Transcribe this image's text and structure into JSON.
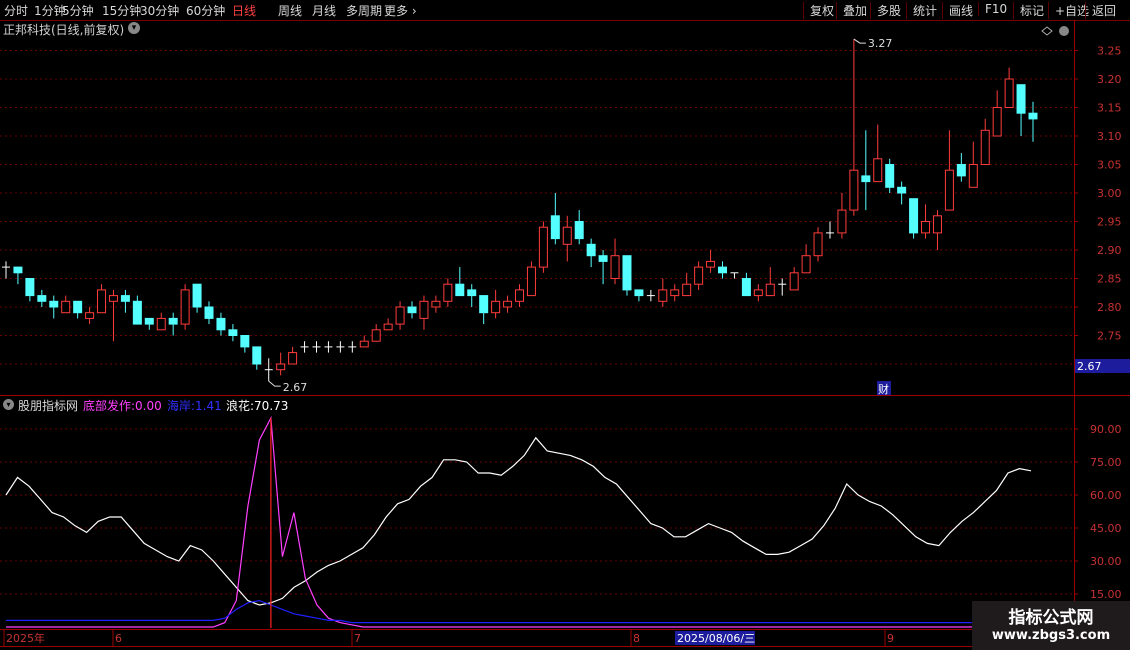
{
  "toolbar": {
    "left": [
      "分时",
      "1分钟",
      "5分钟",
      "15分钟",
      "30分钟",
      "60分钟",
      "日线",
      "周线",
      "月线",
      "多周期",
      "更多"
    ],
    "active": "日线",
    "right": [
      "复权",
      "叠加",
      "多股",
      "统计",
      "画线",
      "F10",
      "标记",
      "+自选",
      "返回"
    ]
  },
  "title": "正邦科技(日线,前复权)",
  "price_panel": {
    "high_label": "3.27",
    "low_label": "2.67",
    "current_price": "2.67",
    "fin_marker": "财",
    "colors": {
      "up": "#ff3c3c",
      "down": "#54ffff",
      "doji": "#ffffff"
    }
  },
  "indicator_panel": {
    "name": "股朋指标网",
    "items": [
      {
        "label": "底部发作:",
        "value": "0.00",
        "color": "#ff40ff"
      },
      {
        "label": "海岸:",
        "value": "1.41",
        "color": "#2020ff"
      },
      {
        "label": "浪花:",
        "value": "70.73",
        "color": "#ffffff"
      }
    ]
  },
  "x_axis": {
    "labels": [
      "2025年",
      "6",
      "7",
      "8",
      "9"
    ],
    "cursor_date": "2025/08/06/三"
  },
  "watermark": {
    "line1": "指标公式网",
    "line2": "www.zbgs3.com"
  },
  "chart_data": [
    {
      "type": "candlestick",
      "title": "正邦科技(日线,前复权)",
      "ylim": [
        2.67,
        3.27
      ],
      "y_ticks": [
        2.7,
        2.75,
        2.8,
        2.85,
        2.9,
        2.95,
        3.0,
        3.05,
        3.1,
        3.15,
        3.2,
        3.25
      ],
      "candles": [
        [
          2.87,
          2.87,
          2.88,
          2.85
        ],
        [
          2.87,
          2.86,
          2.87,
          2.84
        ],
        [
          2.85,
          2.82,
          2.85,
          2.81
        ],
        [
          2.82,
          2.81,
          2.83,
          2.8
        ],
        [
          2.81,
          2.8,
          2.82,
          2.78
        ],
        [
          2.79,
          2.81,
          2.82,
          2.79
        ],
        [
          2.81,
          2.79,
          2.81,
          2.78
        ],
        [
          2.78,
          2.79,
          2.8,
          2.77
        ],
        [
          2.79,
          2.83,
          2.84,
          2.79
        ],
        [
          2.81,
          2.82,
          2.83,
          2.74
        ],
        [
          2.82,
          2.81,
          2.83,
          2.79
        ],
        [
          2.81,
          2.77,
          2.82,
          2.77
        ],
        [
          2.78,
          2.77,
          2.78,
          2.76
        ],
        [
          2.76,
          2.78,
          2.79,
          2.76
        ],
        [
          2.78,
          2.77,
          2.79,
          2.75
        ],
        [
          2.77,
          2.83,
          2.84,
          2.76
        ],
        [
          2.84,
          2.8,
          2.84,
          2.79
        ],
        [
          2.8,
          2.78,
          2.81,
          2.77
        ],
        [
          2.78,
          2.76,
          2.79,
          2.75
        ],
        [
          2.76,
          2.75,
          2.77,
          2.74
        ],
        [
          2.75,
          2.73,
          2.75,
          2.72
        ],
        [
          2.73,
          2.7,
          2.73,
          2.69
        ],
        [
          2.69,
          2.69,
          2.71,
          2.67
        ],
        [
          2.69,
          2.7,
          2.72,
          2.68
        ],
        [
          2.7,
          2.72,
          2.73,
          2.7
        ],
        [
          2.73,
          2.73,
          2.74,
          2.72
        ],
        [
          2.73,
          2.73,
          2.74,
          2.72
        ],
        [
          2.73,
          2.73,
          2.74,
          2.72
        ],
        [
          2.73,
          2.73,
          2.74,
          2.72
        ],
        [
          2.73,
          2.73,
          2.74,
          2.72
        ],
        [
          2.73,
          2.74,
          2.75,
          2.73
        ],
        [
          2.74,
          2.76,
          2.77,
          2.74
        ],
        [
          2.76,
          2.77,
          2.78,
          2.76
        ],
        [
          2.77,
          2.8,
          2.81,
          2.76
        ],
        [
          2.8,
          2.79,
          2.81,
          2.78
        ],
        [
          2.78,
          2.81,
          2.82,
          2.76
        ],
        [
          2.8,
          2.81,
          2.82,
          2.79
        ],
        [
          2.81,
          2.84,
          2.85,
          2.8
        ],
        [
          2.84,
          2.82,
          2.87,
          2.82
        ],
        [
          2.83,
          2.82,
          2.84,
          2.8
        ],
        [
          2.82,
          2.79,
          2.82,
          2.77
        ],
        [
          2.79,
          2.81,
          2.83,
          2.78
        ],
        [
          2.8,
          2.81,
          2.82,
          2.79
        ],
        [
          2.81,
          2.83,
          2.84,
          2.8
        ],
        [
          2.82,
          2.87,
          2.88,
          2.82
        ],
        [
          2.87,
          2.94,
          2.95,
          2.86
        ],
        [
          2.96,
          2.92,
          3.0,
          2.91
        ],
        [
          2.91,
          2.94,
          2.96,
          2.88
        ],
        [
          2.95,
          2.92,
          2.97,
          2.91
        ],
        [
          2.91,
          2.89,
          2.92,
          2.87
        ],
        [
          2.89,
          2.88,
          2.9,
          2.84
        ],
        [
          2.85,
          2.89,
          2.92,
          2.84
        ],
        [
          2.89,
          2.83,
          2.89,
          2.82
        ],
        [
          2.83,
          2.82,
          2.83,
          2.81
        ],
        [
          2.82,
          2.82,
          2.83,
          2.81
        ],
        [
          2.81,
          2.83,
          2.85,
          2.8
        ],
        [
          2.82,
          2.83,
          2.84,
          2.81
        ],
        [
          2.82,
          2.84,
          2.86,
          2.82
        ],
        [
          2.84,
          2.87,
          2.88,
          2.83
        ],
        [
          2.87,
          2.88,
          2.9,
          2.86
        ],
        [
          2.87,
          2.86,
          2.88,
          2.85
        ],
        [
          2.86,
          2.86,
          2.86,
          2.85
        ],
        [
          2.85,
          2.82,
          2.86,
          2.82
        ],
        [
          2.82,
          2.83,
          2.84,
          2.81
        ],
        [
          2.82,
          2.84,
          2.87,
          2.82
        ],
        [
          2.84,
          2.84,
          2.85,
          2.82
        ],
        [
          2.83,
          2.86,
          2.87,
          2.83
        ],
        [
          2.86,
          2.89,
          2.91,
          2.86
        ],
        [
          2.89,
          2.93,
          2.94,
          2.88
        ],
        [
          2.93,
          2.93,
          2.95,
          2.92
        ],
        [
          2.93,
          2.97,
          3.0,
          2.92
        ],
        [
          2.97,
          3.04,
          3.27,
          2.96
        ],
        [
          3.03,
          3.02,
          3.11,
          2.97
        ],
        [
          3.02,
          3.06,
          3.12,
          3.02
        ],
        [
          3.05,
          3.01,
          3.06,
          3.0
        ],
        [
          3.01,
          3.0,
          3.02,
          2.98
        ],
        [
          2.99,
          2.93,
          2.99,
          2.92
        ],
        [
          2.93,
          2.95,
          2.98,
          2.92
        ],
        [
          2.93,
          2.96,
          2.97,
          2.9
        ],
        [
          2.97,
          3.04,
          3.11,
          2.97
        ],
        [
          3.05,
          3.03,
          3.07,
          3.02
        ],
        [
          3.01,
          3.05,
          3.09,
          3.02
        ],
        [
          3.05,
          3.11,
          3.13,
          3.05
        ],
        [
          3.1,
          3.15,
          3.18,
          3.1
        ],
        [
          3.15,
          3.2,
          3.22,
          3.15
        ],
        [
          3.19,
          3.14,
          3.19,
          3.1
        ],
        [
          3.14,
          3.13,
          3.16,
          3.09
        ]
      ]
    },
    {
      "type": "line",
      "title": "股朋指标网",
      "ylim": [
        0,
        100
      ],
      "y_ticks": [
        15.0,
        30.0,
        45.0,
        60.0,
        75.0,
        90.0
      ],
      "series": [
        {
          "name": "浪花",
          "color": "#ffffff",
          "values": [
            60,
            68,
            64,
            58,
            52,
            50,
            46,
            43,
            48,
            50,
            50,
            44,
            38,
            35,
            32,
            30,
            37,
            35,
            30,
            24,
            18,
            12,
            10,
            11,
            13,
            18,
            21,
            25,
            28,
            30,
            33,
            36,
            42,
            50,
            56,
            58,
            64,
            68,
            76,
            76,
            75,
            70,
            70,
            69,
            73,
            78,
            86,
            80,
            79,
            78,
            76,
            73,
            68,
            65,
            59,
            53,
            47,
            45,
            41,
            41,
            44,
            47,
            45,
            43,
            39,
            36,
            33,
            33,
            34,
            37,
            40,
            46,
            54,
            65,
            60,
            57,
            55,
            51,
            46,
            41,
            38,
            37,
            43,
            48,
            52,
            57,
            62,
            70,
            72,
            71
          ]
        },
        {
          "name": "底部发作",
          "color": "#ff40ff",
          "values": [
            0,
            0,
            0,
            0,
            0,
            0,
            0,
            0,
            0,
            0,
            0,
            0,
            0,
            0,
            0,
            0,
            0,
            0,
            0,
            2,
            12,
            55,
            85,
            95,
            32,
            52,
            22,
            10,
            4,
            2,
            1,
            0,
            0,
            0,
            0,
            0,
            0,
            0,
            0,
            0,
            0,
            0,
            0,
            0,
            0,
            0,
            0,
            0,
            0,
            0,
            0,
            0,
            0,
            0,
            0,
            0,
            0,
            0,
            0,
            0,
            0,
            0,
            0,
            0,
            0,
            0,
            0,
            0,
            0,
            0,
            0,
            0,
            0,
            0,
            0,
            0,
            0,
            0,
            0,
            0,
            0,
            0,
            0,
            0,
            0,
            0,
            0,
            0,
            0,
            0
          ]
        },
        {
          "name": "海岸",
          "color": "#2020ff",
          "values": [
            3,
            3,
            3,
            3,
            3,
            3,
            3,
            3,
            3,
            3,
            3,
            3,
            3,
            3,
            3,
            3,
            3,
            3,
            3,
            4,
            8,
            11,
            12,
            10,
            8,
            6,
            5,
            4,
            3,
            3,
            2,
            2,
            2,
            2,
            2,
            2,
            2,
            2,
            2,
            2,
            2,
            2,
            2,
            2,
            2,
            2,
            2,
            2,
            2,
            2,
            2,
            2,
            2,
            2,
            2,
            2,
            2,
            2,
            2,
            2,
            2,
            2,
            2,
            2,
            2,
            2,
            2,
            2,
            2,
            2,
            2,
            2,
            2,
            2,
            2,
            2,
            2,
            2,
            2,
            2,
            2,
            2,
            2,
            2,
            2,
            2,
            2,
            2,
            2,
            2
          ]
        }
      ]
    }
  ]
}
